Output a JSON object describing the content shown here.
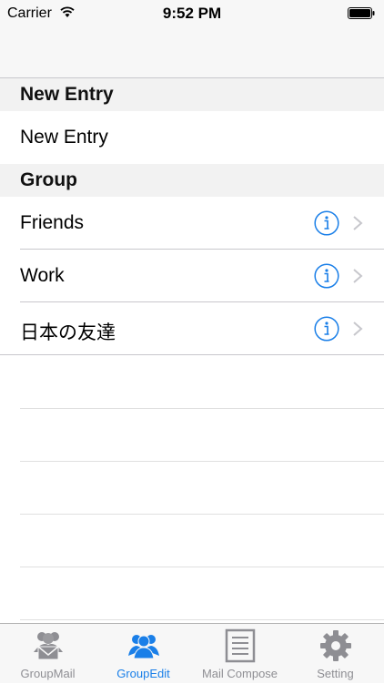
{
  "status_bar": {
    "carrier": "Carrier",
    "time": "9:52 PM",
    "icons": [
      "wifi-icon",
      "battery-icon"
    ]
  },
  "sections": [
    {
      "header": "New Entry",
      "rows": [
        {
          "label": "New Entry"
        }
      ]
    },
    {
      "header": "Group",
      "rows": [
        {
          "label": "Friends",
          "accessories": [
            "info-icon",
            "chevron-right-icon"
          ]
        },
        {
          "label": "Work",
          "accessories": [
            "info-icon",
            "chevron-right-icon"
          ]
        },
        {
          "label": "日本の友達",
          "accessories": [
            "info-icon",
            "chevron-right-icon"
          ]
        }
      ]
    }
  ],
  "tab_bar": {
    "tabs": [
      {
        "label": "GroupMail",
        "icon": "group-mail-icon",
        "active": false
      },
      {
        "label": "GroupEdit",
        "icon": "group-icon",
        "active": true
      },
      {
        "label": "Mail Compose",
        "icon": "compose-icon",
        "active": false
      },
      {
        "label": "Setting",
        "icon": "gear-icon",
        "active": false
      }
    ]
  },
  "colors": {
    "accent": "#1a7fe8",
    "inactive_tab": "#8e8e93",
    "section_background": "#f2f2f2",
    "separator": "#c8c7cc"
  }
}
